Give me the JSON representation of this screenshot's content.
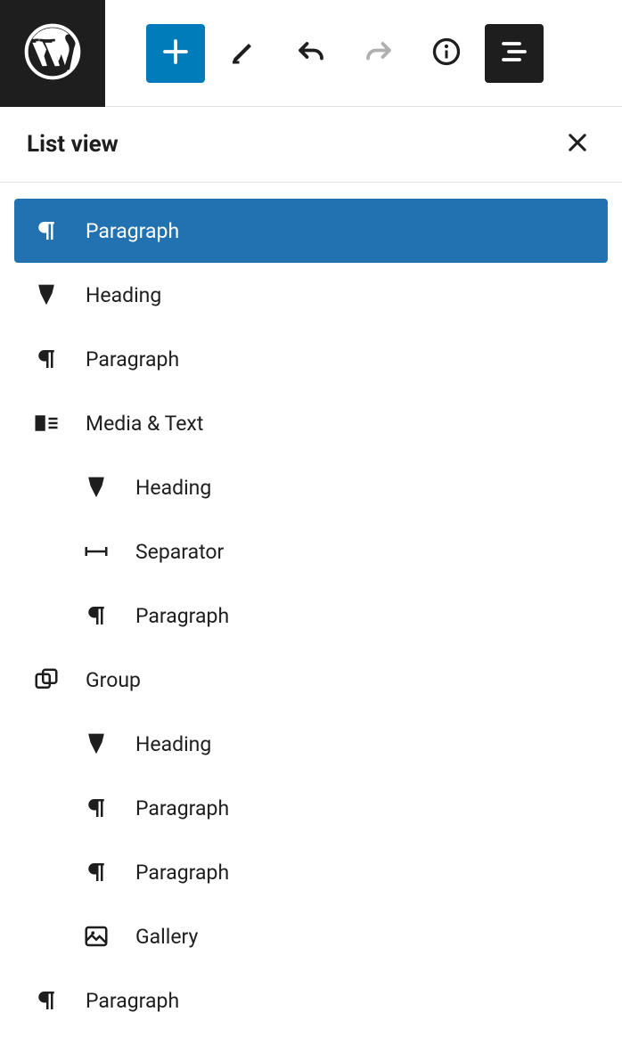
{
  "panel": {
    "title": "List view"
  },
  "blocks": [
    {
      "label": "Paragraph",
      "icon": "paragraph",
      "indent": 0,
      "selected": true
    },
    {
      "label": "Heading",
      "icon": "heading",
      "indent": 0,
      "selected": false
    },
    {
      "label": "Paragraph",
      "icon": "paragraph",
      "indent": 0,
      "selected": false
    },
    {
      "label": "Media & Text",
      "icon": "media-text",
      "indent": 0,
      "selected": false
    },
    {
      "label": "Heading",
      "icon": "heading",
      "indent": 1,
      "selected": false
    },
    {
      "label": "Separator",
      "icon": "separator",
      "indent": 1,
      "selected": false
    },
    {
      "label": "Paragraph",
      "icon": "paragraph",
      "indent": 1,
      "selected": false
    },
    {
      "label": "Group",
      "icon": "group",
      "indent": 0,
      "selected": false
    },
    {
      "label": "Heading",
      "icon": "heading",
      "indent": 1,
      "selected": false
    },
    {
      "label": "Paragraph",
      "icon": "paragraph",
      "indent": 1,
      "selected": false
    },
    {
      "label": "Paragraph",
      "icon": "paragraph",
      "indent": 1,
      "selected": false
    },
    {
      "label": "Gallery",
      "icon": "gallery",
      "indent": 1,
      "selected": false
    },
    {
      "label": "Paragraph",
      "icon": "paragraph",
      "indent": 0,
      "selected": false
    }
  ]
}
